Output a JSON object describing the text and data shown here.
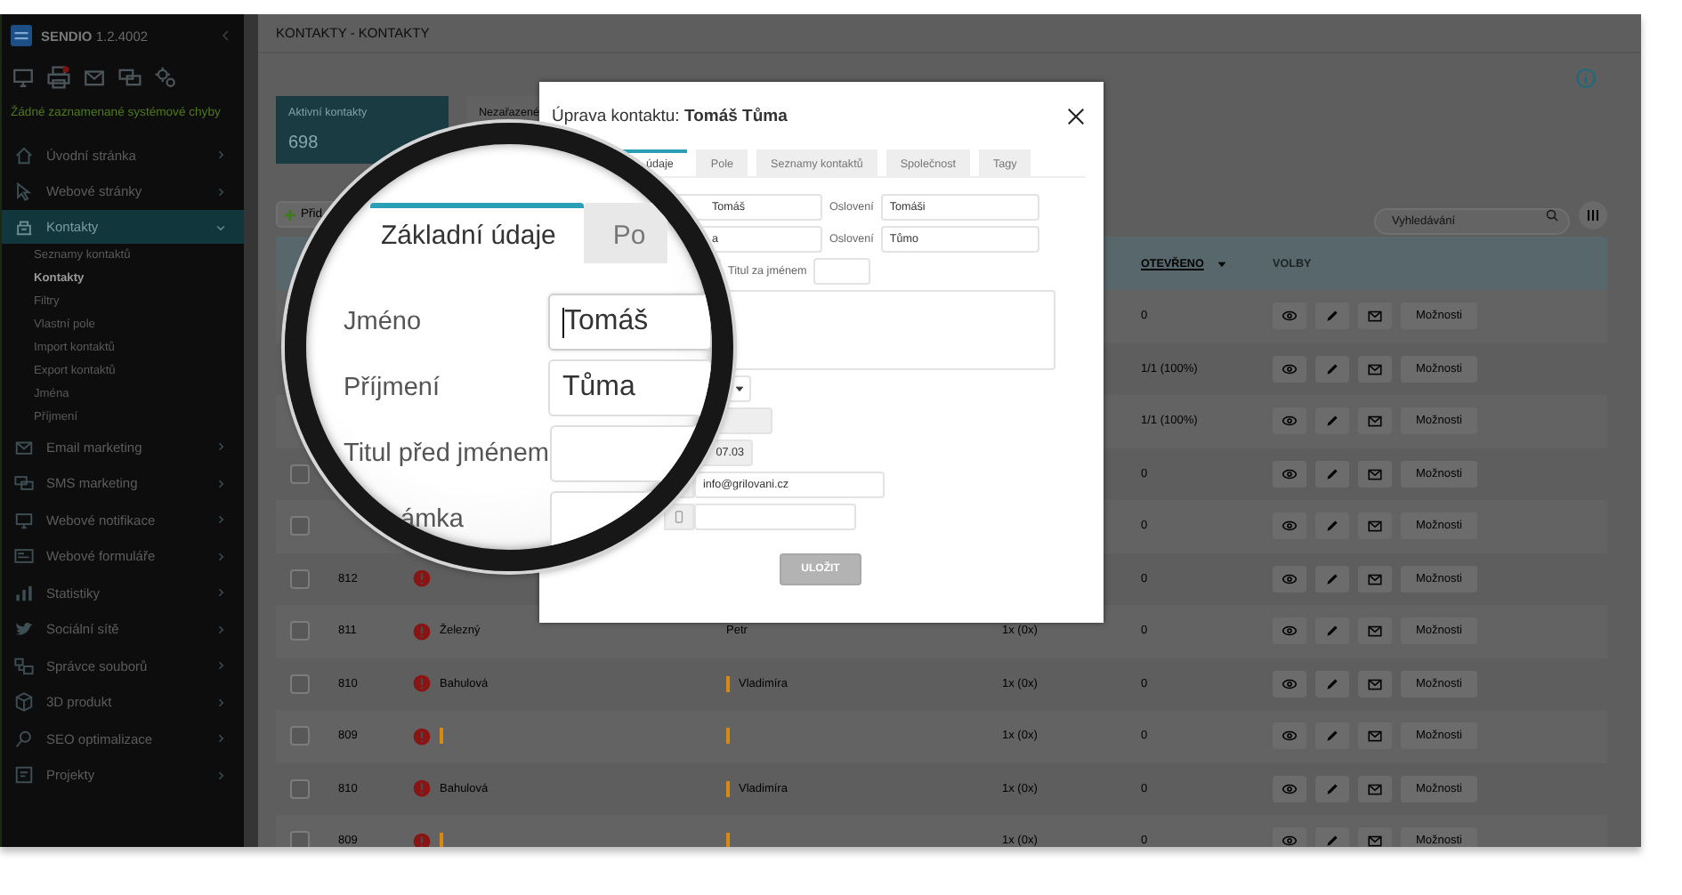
{
  "sidebar": {
    "app_name": "SENDIO",
    "version": "1.2.4002",
    "status_message": "Žádné zaznamenané systémové chyby",
    "items": [
      {
        "label": "Úvodní stránka",
        "selected": false,
        "expanded": false
      },
      {
        "label": "Webové stránky",
        "selected": false,
        "expanded": false
      },
      {
        "label": "Kontakty",
        "selected": true,
        "expanded": true,
        "children": [
          {
            "label": "Seznamy kontaktů",
            "selected": false
          },
          {
            "label": "Kontakty",
            "selected": true
          },
          {
            "label": "Filtry",
            "selected": false
          },
          {
            "label": "Vlastní pole",
            "selected": false
          },
          {
            "label": "Import kontaktů",
            "selected": false
          },
          {
            "label": "Export kontaktů",
            "selected": false
          },
          {
            "label": "Jména",
            "selected": false
          },
          {
            "label": "Příjmení",
            "selected": false
          }
        ]
      },
      {
        "label": "Email marketing",
        "selected": false,
        "expanded": false
      },
      {
        "label": "SMS marketing",
        "selected": false,
        "expanded": false
      },
      {
        "label": "Webové notifikace",
        "selected": false,
        "expanded": false
      },
      {
        "label": "Webové formuláře",
        "selected": false,
        "expanded": false
      },
      {
        "label": "Statistiky",
        "selected": false,
        "expanded": false
      },
      {
        "label": "Sociální sítě",
        "selected": false,
        "expanded": false
      },
      {
        "label": "Správce souborů",
        "selected": false,
        "expanded": false
      },
      {
        "label": "3D produkt",
        "selected": false,
        "expanded": false
      },
      {
        "label": "SEO optimalizace",
        "selected": false,
        "expanded": false
      },
      {
        "label": "Projekty",
        "selected": false,
        "expanded": false
      }
    ]
  },
  "page": {
    "title": "KONTAKTY - KONTAKTY"
  },
  "stat_cards": [
    {
      "label": "Aktivní kontakty",
      "value": "698",
      "selected": true
    },
    {
      "label": "Nezařazené",
      "selected": false
    }
  ],
  "add_button": {
    "label": "Přid"
  },
  "search": {
    "placeholder": "Vyhledávání"
  },
  "table": {
    "columns": [
      {
        "label": "OTEVŘENO",
        "sorted": true
      },
      {
        "label": "VOLBY",
        "sorted": false
      }
    ],
    "rows": [
      {
        "opened": "0",
        "options": "Možnosti"
      },
      {
        "opened": "1/1 (100%)",
        "options": "Možnosti"
      },
      {
        "opened": "1/1 (100%)",
        "options": "Možnosti"
      },
      {
        "checked": false,
        "opened": "0",
        "options": "Možnosti"
      },
      {
        "checked": false,
        "opened": "0",
        "options": "Možnosti"
      },
      {
        "checked": false,
        "id": "812",
        "alert": true,
        "opened": "0",
        "options": "Možnosti"
      },
      {
        "checked": false,
        "id": "811",
        "alert": true,
        "surname": "Železný",
        "first_name": "Petr",
        "first_name_flag": false,
        "sent": "1x (0x)",
        "opened": "0",
        "options": "Možnosti"
      },
      {
        "checked": false,
        "id": "810",
        "alert": true,
        "surname": "Bahulová",
        "first_name": "Vladimíra",
        "first_name_flag": true,
        "sent": "1x (0x)",
        "opened": "0",
        "options": "Možnosti"
      },
      {
        "checked": false,
        "id": "809",
        "alert": true,
        "surname_flag": true,
        "first_name_flag": true,
        "sent": "1x (0x)",
        "opened": "0",
        "options": "Možnosti"
      },
      {
        "checked": false,
        "id": "810",
        "alert": true,
        "surname": "Bahulová",
        "first_name": "Vladimíra",
        "first_name_flag": true,
        "sent": "1x (0x)",
        "opened": "0",
        "options": "Možnosti"
      },
      {
        "checked": false,
        "id": "809",
        "alert": true,
        "surname_flag": true,
        "first_name_flag": true,
        "sent": "1x (0x)",
        "opened": "0",
        "options": "Možnosti"
      }
    ]
  },
  "modal": {
    "title": "Úprava kontaktu: **Tomáš Tůma**",
    "tabs": [
      {
        "label": "údaje",
        "selected": true
      },
      {
        "label": "Pole",
        "selected": false
      },
      {
        "label": "Seznamy kontaktů",
        "selected": false
      },
      {
        "label": "Společnost",
        "selected": false
      },
      {
        "label": "Tagy",
        "selected": false
      }
    ],
    "first_name": "Tomáš",
    "first_name_salutation_label": "Oslovení",
    "first_name_salutation": "Tomáši",
    "surname": "a",
    "surname_salutation_label": "Oslovení",
    "surname_salutation": "Tůmo",
    "title_after_label": "Titul za jménem",
    "date": "07.03",
    "email": "info@grilovani.cz",
    "save_button": {
      "label": "ULOŽIT",
      "disabled": true
    }
  },
  "magnifier": {
    "tabs": [
      {
        "label": "Základní údaje",
        "selected": true
      },
      {
        "label": "Po",
        "selected": false
      }
    ],
    "fields": [
      {
        "label": "Jméno",
        "value": "Tomáš",
        "focused": true
      },
      {
        "label": "Příjmení",
        "value": "Tůma",
        "focused": false
      },
      {
        "label": "Titul před jménem",
        "focused": false
      },
      {
        "label": "ámka",
        "focused": false
      }
    ]
  }
}
